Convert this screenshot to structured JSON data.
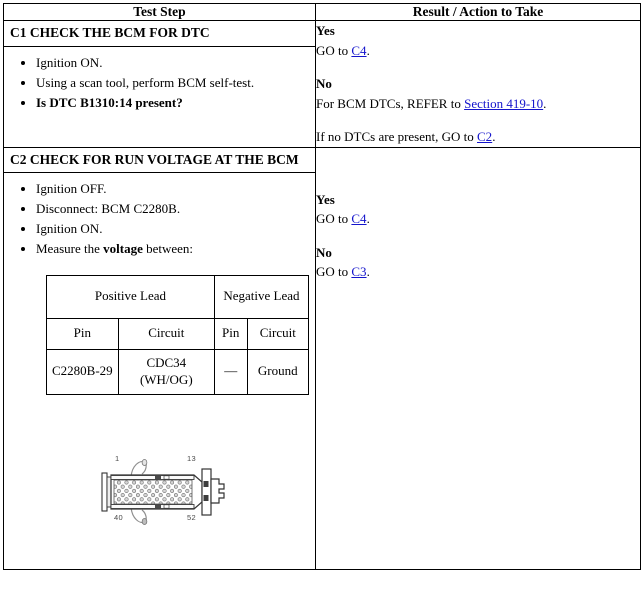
{
  "document": {
    "type": "pinpoint-test-table",
    "link_color": "#1414cc"
  },
  "table": {
    "headers": {
      "test_step": "Test Step",
      "result_action": "Result / Action to Take"
    },
    "steps": [
      {
        "id": "C1",
        "title": "C1 CHECK THE BCM FOR DTC",
        "bullets": [
          {
            "text": "Ignition ON.",
            "bold": false
          },
          {
            "text": "Using a scan tool, perform BCM self-test.",
            "bold": false
          },
          {
            "text": "Is DTC B1310:14 present?",
            "bold": true
          }
        ],
        "result": {
          "yes_label": "Yes",
          "yes_text_prefix": "GO to ",
          "yes_link": "C4",
          "yes_text_suffix": ".",
          "no_label": "No",
          "no_text_prefix": "For BCM DTCs, REFER to ",
          "no_link": "Section 419-10",
          "no_text_suffix": ".",
          "extra_prefix": "If no DTCs are present, GO to ",
          "extra_link": "C2",
          "extra_suffix": "."
        }
      },
      {
        "id": "C2",
        "title": "C2 CHECK FOR RUN VOLTAGE AT THE BCM",
        "bullets": [
          {
            "text": "Ignition OFF.",
            "bold": false
          },
          {
            "text": "Disconnect: BCM C2280B.",
            "bold": false
          },
          {
            "text": "Ignition ON.",
            "bold": false
          },
          {
            "text": "Measure the voltage between:",
            "bold": false,
            "bold_word": "voltage"
          }
        ],
        "result": {
          "yes_label": "Yes",
          "yes_text_prefix": "GO to ",
          "yes_link": "C4",
          "yes_text_suffix": ".",
          "no_label": "No",
          "no_text_prefix": "GO to ",
          "no_link": "C3",
          "no_text_suffix": "."
        },
        "measurement_table": {
          "group_headers": [
            "Positive Lead",
            "Negative Lead"
          ],
          "sub_headers": [
            "Pin",
            "Circuit",
            "Pin",
            "Circuit"
          ],
          "rows": [
            [
              "C2280B-29",
              "CDC34 (WH/OG)",
              "—",
              "Ground"
            ]
          ]
        },
        "connector_figure": {
          "name": "C2280B connector face view",
          "pin_labels": {
            "top_left": "1",
            "top_right": "13",
            "bottom_left": "40",
            "bottom_right": "52"
          },
          "grid_rows": 4,
          "grid_cols": 13
        }
      }
    ]
  }
}
